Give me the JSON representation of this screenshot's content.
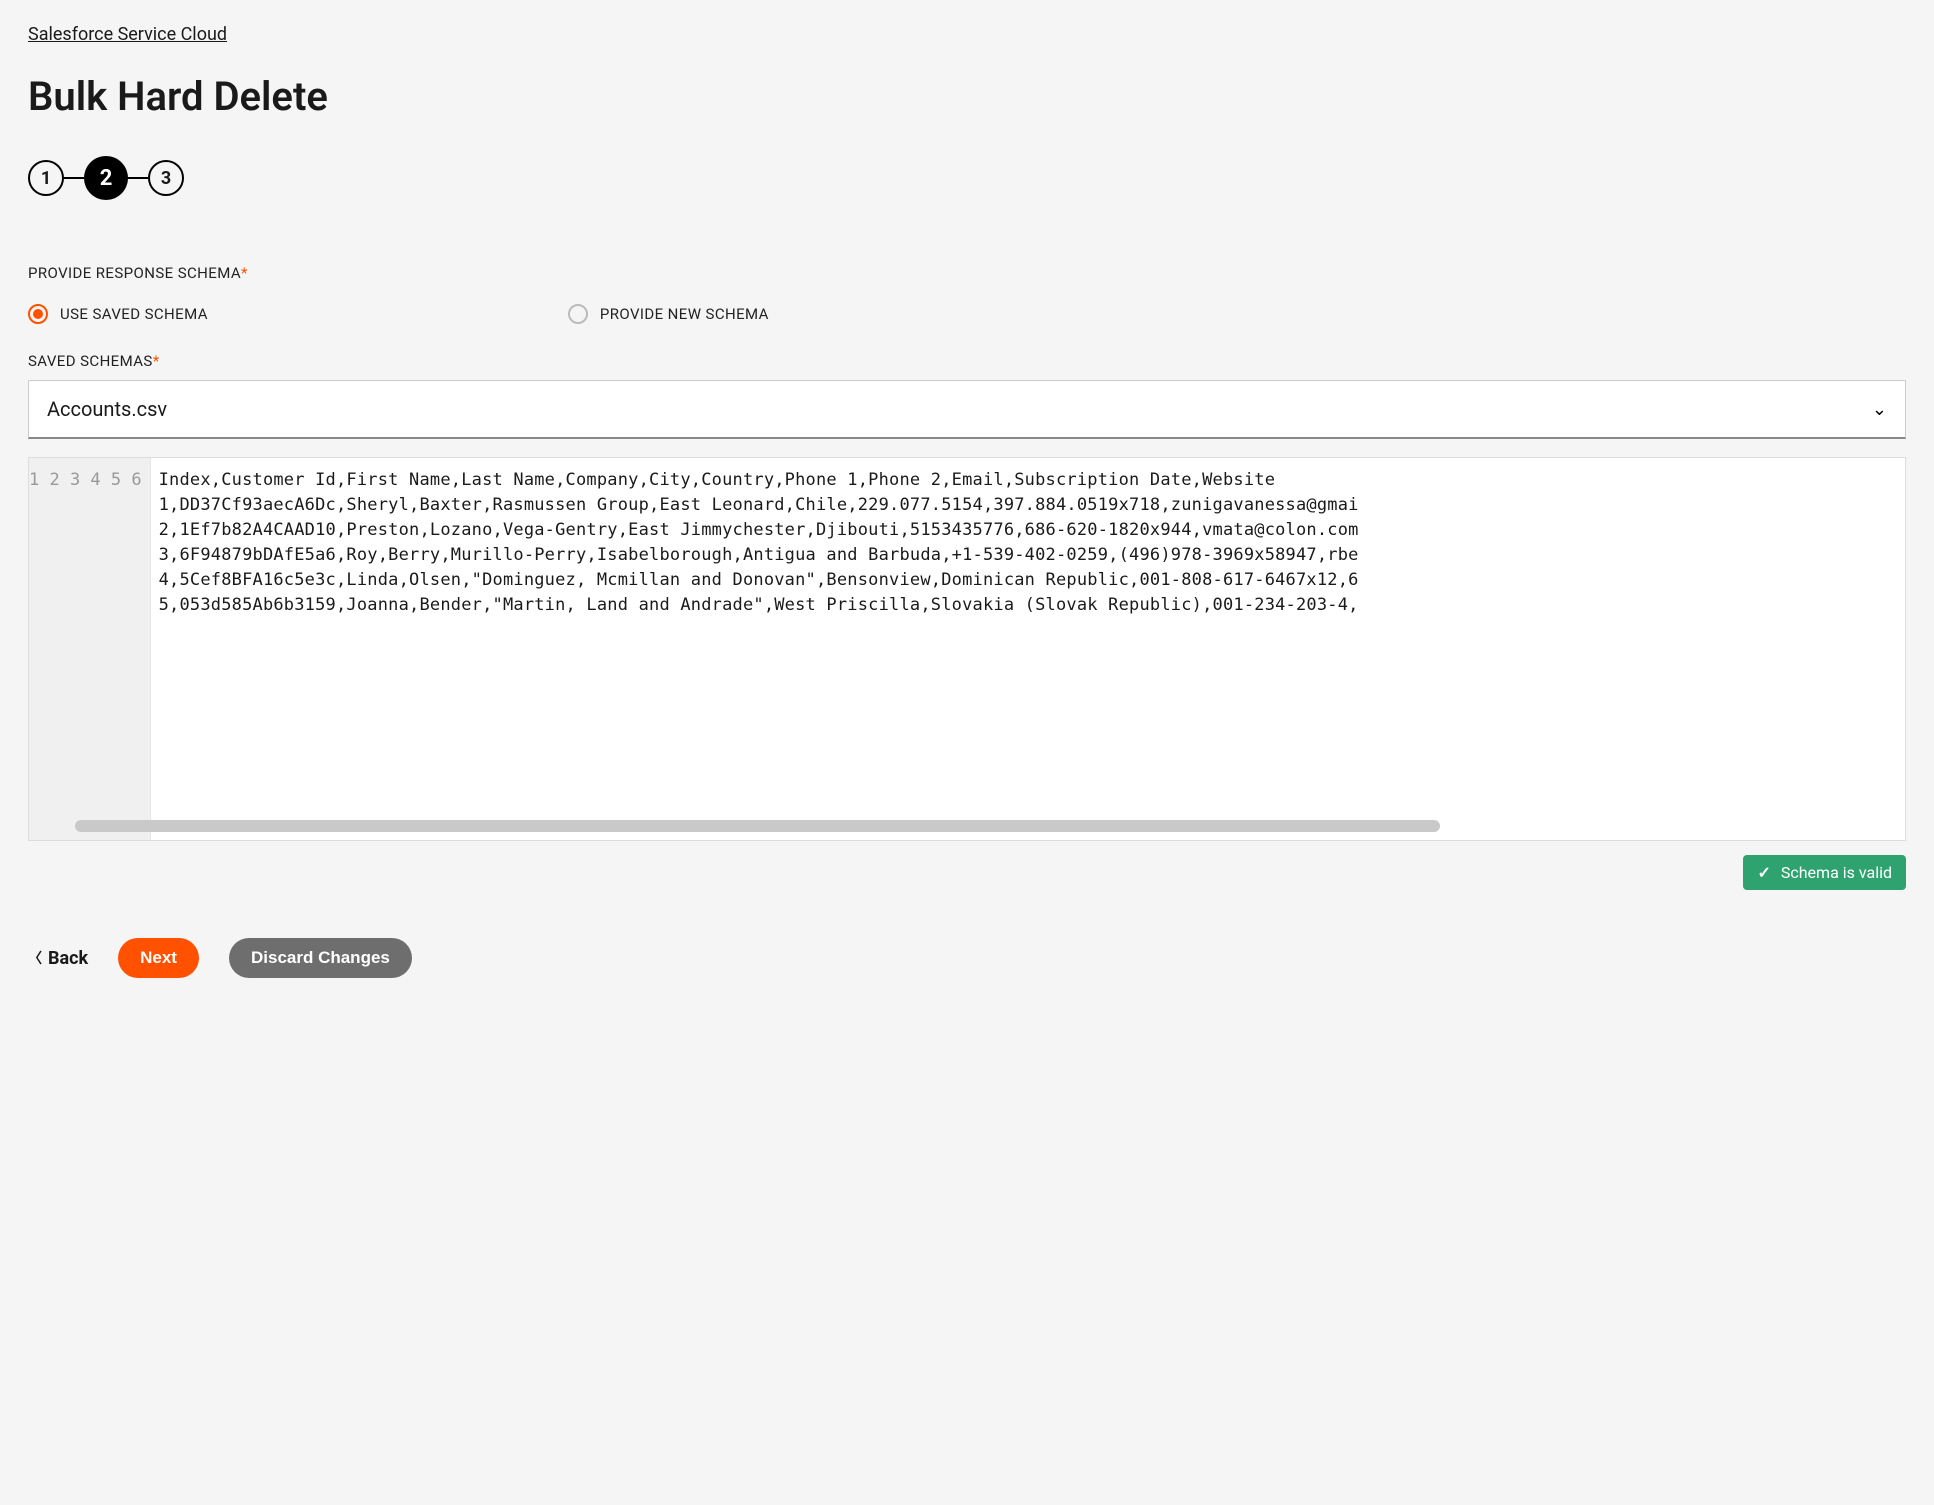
{
  "breadcrumb": "Salesforce Service Cloud",
  "title": "Bulk Hard Delete",
  "steps": [
    "1",
    "2",
    "3"
  ],
  "activeStep": 2,
  "schemaSection": {
    "label": "PROVIDE RESPONSE SCHEMA",
    "options": {
      "useSaved": "USE SAVED SCHEMA",
      "provideNew": "PROVIDE NEW SCHEMA"
    },
    "selected": "useSaved"
  },
  "savedSchemas": {
    "label": "SAVED SCHEMAS",
    "selected": "Accounts.csv"
  },
  "editor": {
    "lines": [
      "Index,Customer Id,First Name,Last Name,Company,City,Country,Phone 1,Phone 2,Email,Subscription Date,Website",
      "1,DD37Cf93aecA6Dc,Sheryl,Baxter,Rasmussen Group,East Leonard,Chile,229.077.5154,397.884.0519x718,zunigavanessa@gmai",
      "2,1Ef7b82A4CAAD10,Preston,Lozano,Vega-Gentry,East Jimmychester,Djibouti,5153435776,686-620-1820x944,vmata@colon.com",
      "3,6F94879bDAfE5a6,Roy,Berry,Murillo-Perry,Isabelborough,Antigua and Barbuda,+1-539-402-0259,(496)978-3969x58947,rbe",
      "4,5Cef8BFA16c5e3c,Linda,Olsen,\"Dominguez, Mcmillan and Donovan\",Bensonview,Dominican Republic,001-808-617-6467x12,6",
      "5,053d585Ab6b3159,Joanna,Bender,\"Martin, Land and Andrade\",West Priscilla,Slovakia (Slovak Republic),001-234-203-4,"
    ]
  },
  "status": "Schema is valid",
  "buttons": {
    "back": "Back",
    "next": "Next",
    "discard": "Discard Changes"
  }
}
